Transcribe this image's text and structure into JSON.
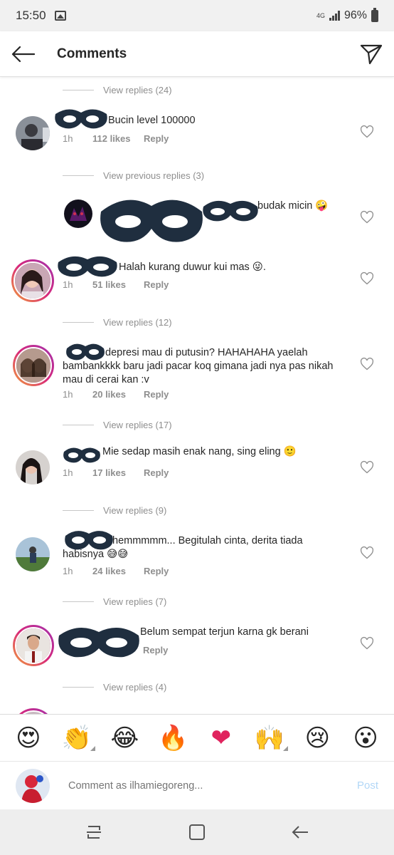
{
  "status": {
    "time": "15:50",
    "network": "4G",
    "battery": "96%"
  },
  "header": {
    "title": "Comments"
  },
  "view_replies": [
    "View replies (24)",
    "View previous replies (3)",
    "View replies (12)",
    "View replies (17)",
    "View replies (9)",
    "View replies (7)",
    "View replies (4)"
  ],
  "comments": [
    {
      "text": "Bucin level 100000",
      "time": "1h",
      "likes": "112 likes",
      "reply": "Reply"
    },
    {
      "text": "budak micin 🤪"
    },
    {
      "text": "Halah kurang duwur kui mas 😜.",
      "time": "1h",
      "likes": "51 likes",
      "reply": "Reply"
    },
    {
      "text": "depresi mau di putusin? HAHAHAHA yaelah bambankkkk baru jadi pacar koq gimana jadi nya pas nikah mau di cerai kan :v",
      "time": "1h",
      "likes": "20 likes",
      "reply": "Reply"
    },
    {
      "text": "Mie sedap masih enak nang,  sing eling 🙂",
      "time": "1h",
      "likes": "17 likes",
      "reply": "Reply"
    },
    {
      "text": "hemmmmm... Begitulah cinta, derita tiada habisnya 😅😅",
      "time": "1h",
      "likes": "24 likes",
      "reply": "Reply"
    },
    {
      "text": "Belum sempat terjun karna gk berani",
      "reply": "Reply"
    }
  ],
  "reactions": [
    "😍",
    "👏",
    "😂",
    "🔥",
    "❤",
    "🙌",
    "😢",
    "😮"
  ],
  "composer": {
    "placeholder": "Comment as ilhamiegoreng...",
    "post_label": "Post"
  },
  "colors": {
    "meta_gray": "#8e8e8e",
    "text": "#262626",
    "story_ring_start": "#f2a23a",
    "story_ring_end": "#a033b0",
    "post_disabled": "#b2d7f7",
    "mask": "#1f2e3f"
  }
}
